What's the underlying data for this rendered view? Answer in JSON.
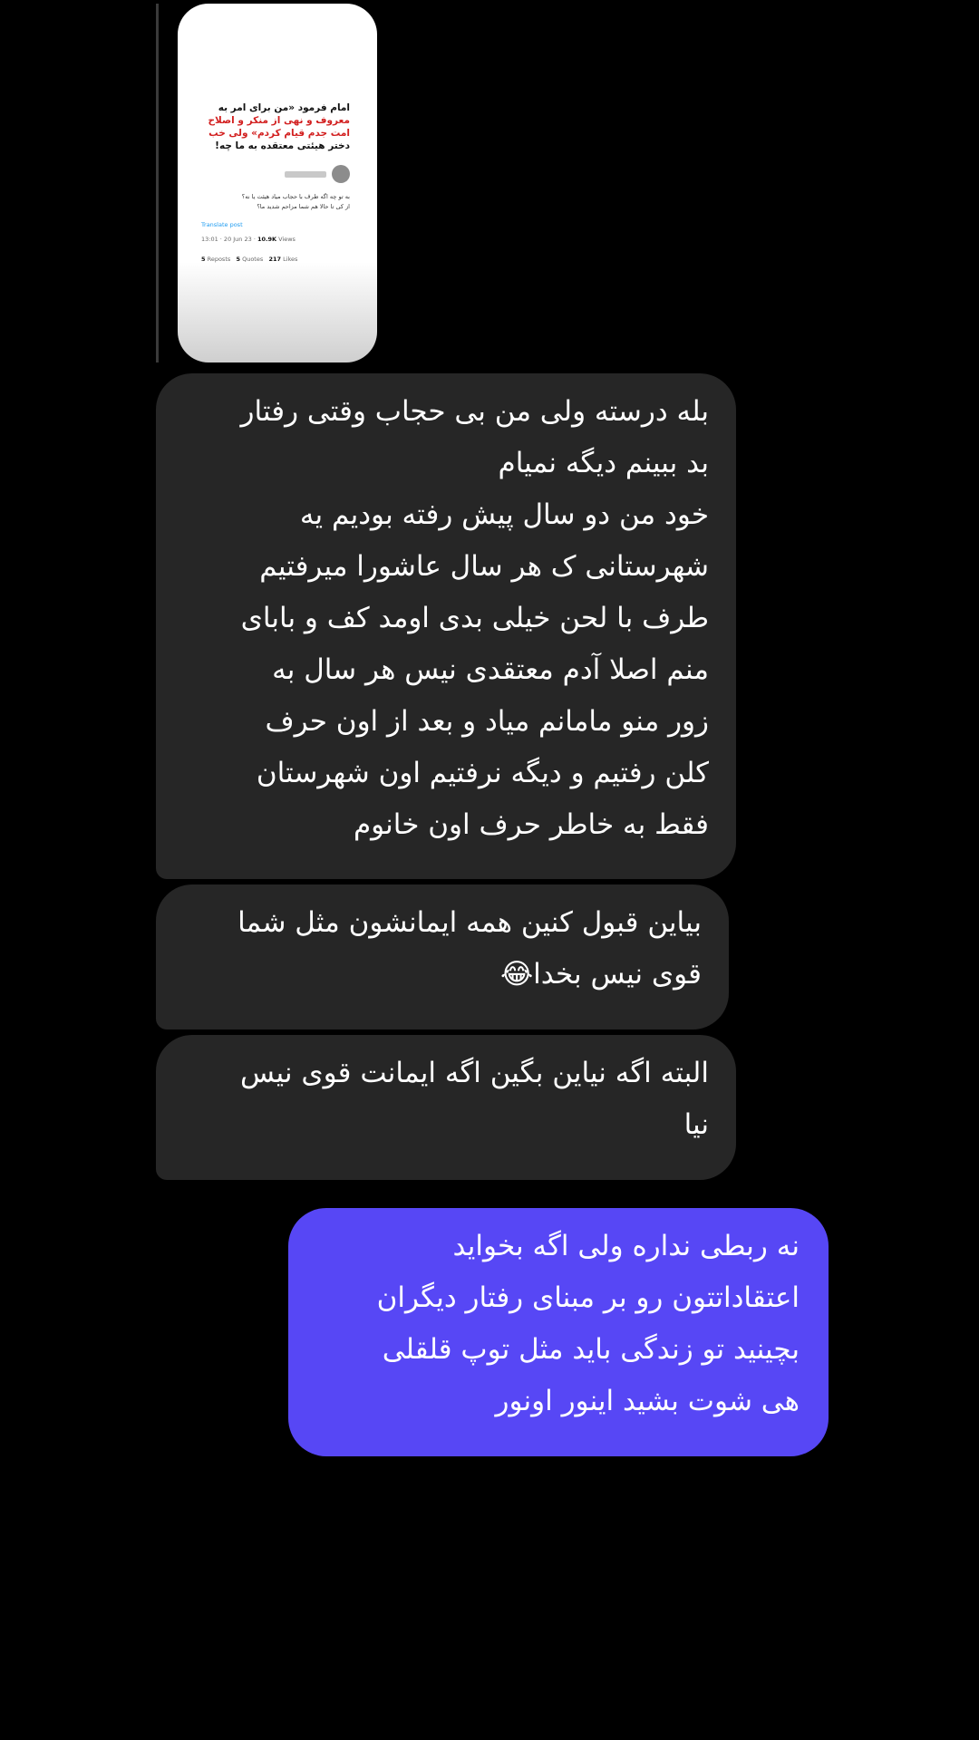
{
  "shared_post": {
    "quote_line_1": "امام فرمود «من برای امر به",
    "quote_line_2": "معروف و نهی از منکر و اصلاح",
    "quote_line_3": "امت جدم قیام کردم» ولی خب",
    "quote_line_4": "دختر هیئتی معتقده به ما چه!",
    "reply_line_1": "به تو چه اگه طرف با حجاب میاد هیئت یا نه؟",
    "reply_line_2": "از کی تا حالا هم شما مزاحم شدید ما؟",
    "link": "Translate post",
    "time": "13:01 · 20 Jun 23 · ",
    "views": "10.9K",
    "views_label": "Views",
    "reposts_count": "5",
    "reposts_label": "Reposts",
    "quotes_count": "5",
    "quotes_label": "Quotes",
    "likes_count": "217",
    "likes_label": "Likes"
  },
  "messages": [
    {
      "direction": "incoming",
      "lines": [
        "بله درسته ولی من بی حجاب وقتی رفتار",
        "بد ببینم دیگه نمیام",
        "خود من دو سال پیش رفته بودیم یه",
        "شهرستانی ک هر سال عاشورا میرفتیم",
        "طرف با لحن خیلی بدی اومد کف و بابای",
        "منم اصلا آدم معتقدی نیس هر سال به",
        "زور منو مامانم میاد و بعد از اون حرف",
        "کلن رفتیم و دیگه نرفتیم اون شهرستان",
        "فقط به خاطر حرف اون خانوم"
      ]
    },
    {
      "direction": "incoming",
      "lines": [
        "بیاین قبول کنین همه ایمانشون مثل شما",
        "قوی نیس بخدا😂"
      ]
    },
    {
      "direction": "incoming",
      "lines": [
        "البته اگه نیاین بگین اگه ایمانت قوی نیس",
        "نیا"
      ]
    },
    {
      "direction": "outgoing",
      "lines": [
        "نه ربطی نداره ولی اگه بخواید",
        "اعتقاداتتون رو بر مبنای رفتار دیگران",
        "بچینید تو زندگی باید مثل توپ قلقلی",
        "هی شوت بشید اینور اونور"
      ]
    }
  ],
  "colors": {
    "background": "#000000",
    "incoming_bubble": "#262626",
    "outgoing_bubble": "#5747f5",
    "text": "#ffffff"
  }
}
